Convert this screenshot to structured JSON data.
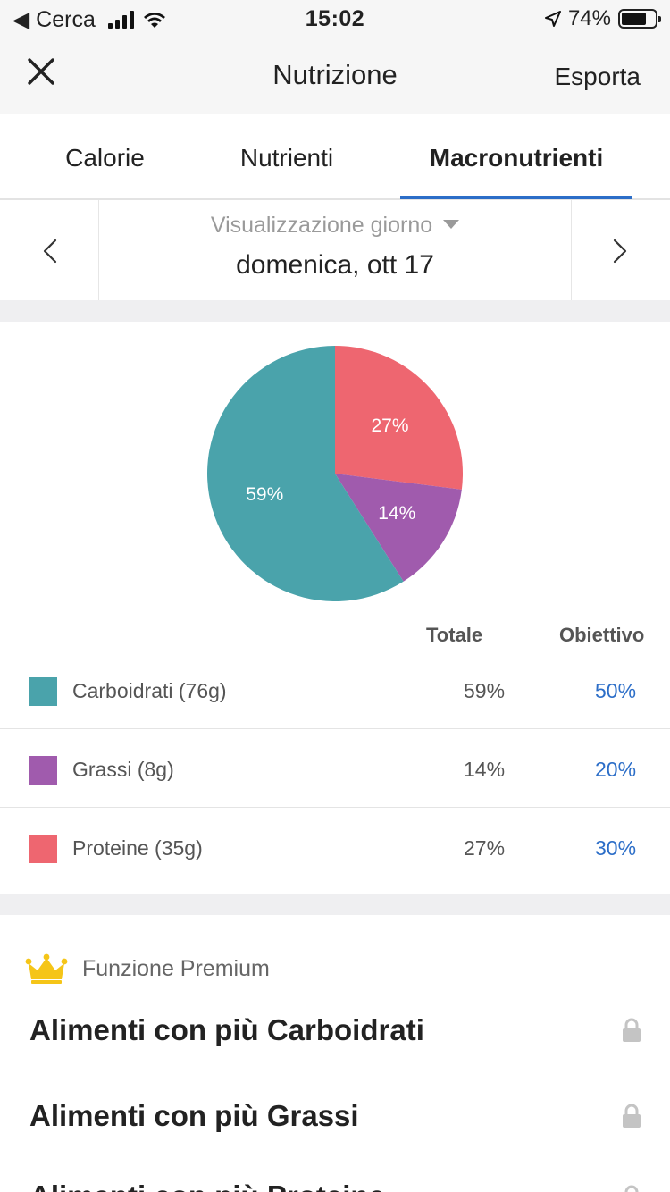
{
  "status_bar": {
    "back_label": "◀ Cerca",
    "time": "15:02",
    "battery": "74%",
    "battery_level": 0.74
  },
  "navbar": {
    "title": "Nutrizione",
    "export_label": "Esporta"
  },
  "tabs": [
    {
      "label": "Calorie"
    },
    {
      "label": "Nutrienti"
    },
    {
      "label": "Macronutrienti"
    }
  ],
  "date_selector": {
    "view_label": "Visualizzazione giorno",
    "date": "domenica, ott 17"
  },
  "chart_data": {
    "type": "pie",
    "slices": [
      {
        "label": "Proteine",
        "percent": 27,
        "color": "#ee6670"
      },
      {
        "label": "Grassi",
        "percent": 14,
        "color": "#a05bad"
      },
      {
        "label": "Carboidrati",
        "percent": 59,
        "color": "#4aa3ab"
      }
    ],
    "slice_labels": [
      "27%",
      "14%",
      "59%"
    ]
  },
  "table": {
    "total_header": "Totale",
    "goal_header": "Obiettivo",
    "rows": [
      {
        "name": "Carboidrati (76g)",
        "total": "59%",
        "goal": "50%",
        "color": "#4aa3ab"
      },
      {
        "name": "Grassi (8g)",
        "total": "14%",
        "goal": "20%",
        "color": "#a05bad"
      },
      {
        "name": "Proteine  (35g)",
        "total": "27%",
        "goal": "30%",
        "color": "#ee6670"
      }
    ]
  },
  "premium": {
    "label": "Funzione Premium",
    "features": [
      "Alimenti con più Carboidrati",
      "Alimenti con più Grassi",
      "Alimenti con più Proteine"
    ]
  }
}
